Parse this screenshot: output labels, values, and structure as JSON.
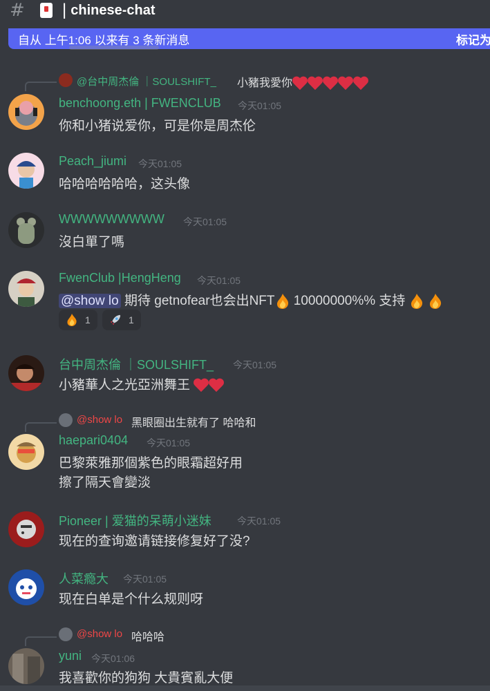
{
  "channel": {
    "name": "chinese-chat",
    "hash_icon": "#",
    "separator": "|"
  },
  "new_messages_bar": {
    "text": "自从 上午1:06 以来有 3 条新消息",
    "action": "标记为"
  },
  "colors": {
    "accent": "#5865f2",
    "username_green": "#43b581",
    "mention_pink": "#f04747",
    "background": "#36393f"
  },
  "messages": [
    {
      "reply": {
        "author": "@台中周杰倫 ｜SOULSHIFT_",
        "text": "小豬我愛你"
      },
      "author": "benchoong.eth | FWENCLUB",
      "time": "今天01:05",
      "text": "你和小猪说爱你，可是你是周杰伦"
    },
    {
      "author": "Peach_jiumi",
      "time": "今天01:05",
      "text": "哈哈哈哈哈哈，这头像"
    },
    {
      "author": "WWWWWWWWW",
      "time": "今天01:05",
      "text": "沒白單了嗎"
    },
    {
      "author": "FwenClub |HengHeng",
      "time": "今天01:05",
      "mention": "@show lo",
      "text_a": "期待 getnofear也会出NFT",
      "text_b": "10000000%% 支持",
      "reactions": [
        {
          "emoji": "fire-emoji",
          "count": "1"
        },
        {
          "emoji": "rocket-emoji",
          "count": "1"
        }
      ]
    },
    {
      "author": "台中周杰倫 ｜SOULSHIFT_",
      "time": "今天01:05",
      "text": "小豬華人之光亞洲舞王"
    },
    {
      "reply": {
        "author": "@show lo",
        "text": "黑眼圈出生就有了 哈哈和"
      },
      "author": "haepari0404",
      "time": "今天01:05",
      "text": "巴黎萊雅那個紫色的眼霜超好用",
      "text2": "擦了隔天會變淡"
    },
    {
      "author": "Pioneer | 爱猫的呆萌小迷妹",
      "time": "今天01:05",
      "text": "现在的查询邀请链接修复好了没?"
    },
    {
      "author": "人菜瘾大",
      "time": "今天01:05",
      "text": "现在白单是个什么规则呀"
    },
    {
      "reply": {
        "author": "@show lo",
        "text": "哈哈哈"
      },
      "author": "yuni",
      "time": "今天01:06",
      "text": "我喜歡你的狗狗 大貴賓亂大便"
    }
  ]
}
